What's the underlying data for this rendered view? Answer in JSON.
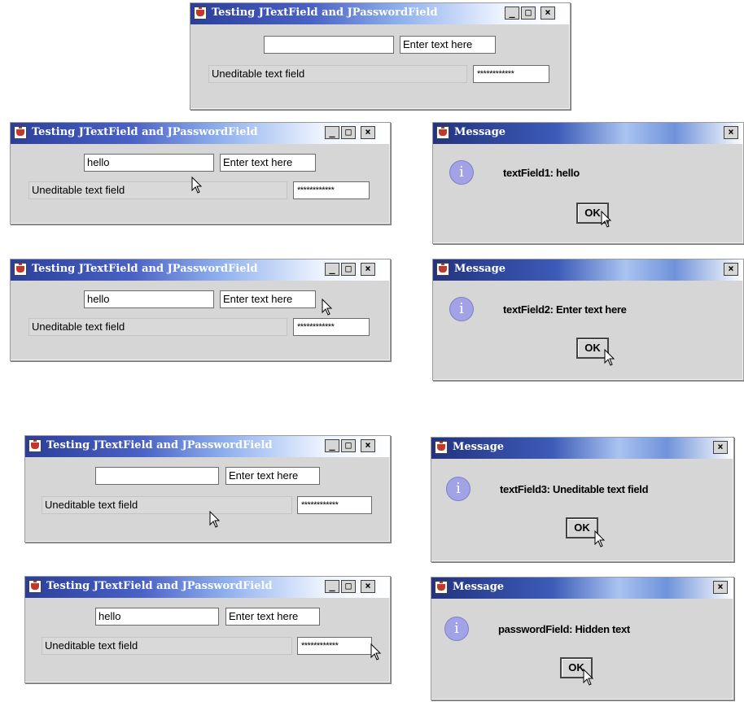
{
  "main_window": {
    "title": "Testing JTextField and JPasswordField",
    "text_field_1_value": "",
    "text_field_2_value": "Enter text here",
    "text_field_3_value": "Uneditable text field",
    "password_field_value": "************"
  },
  "panels": [
    {
      "title": "Testing JTextField and JPasswordField",
      "text_field_1_value": "hello",
      "text_field_2_value": "Enter text here",
      "text_field_3_value": "Uneditable text field",
      "password_field_value": "************",
      "dialog": {
        "title": "Message",
        "message": "textField1: hello",
        "ok_label": "OK"
      }
    },
    {
      "title": "Testing JTextField and JPasswordField",
      "text_field_1_value": "hello",
      "text_field_2_value": "Enter text here",
      "text_field_3_value": "Uneditable text field",
      "password_field_value": "************",
      "dialog": {
        "title": "Message",
        "message": "textField2: Enter text here",
        "ok_label": "OK"
      }
    },
    {
      "title": "Testing JTextField and JPasswordField",
      "text_field_1_value": "",
      "text_field_2_value": "Enter text here",
      "text_field_3_value": "Uneditable text field",
      "password_field_value": "************",
      "dialog": {
        "title": "Message",
        "message": "textField3: Uneditable text field",
        "ok_label": "OK"
      }
    },
    {
      "title": "Testing JTextField and JPasswordField",
      "text_field_1_value": "hello",
      "text_field_2_value": "Enter text here",
      "text_field_3_value": "Uneditable text field",
      "password_field_value": "************",
      "dialog": {
        "title": "Message",
        "message": "passwordField: Hidden text",
        "ok_label": "OK"
      }
    }
  ],
  "window_controls": {
    "minimize_glyph": "_",
    "maximize_glyph": "□",
    "close_glyph": "×"
  },
  "info_icon_glyph": "i",
  "icons": [
    "app-cup-icon",
    "info-icon",
    "mouse-pointer-icon"
  ],
  "colors": {
    "window_bg": "#d6d6d6",
    "title_dark": "#2b3f9a",
    "info_icon": "#a2a2e6"
  }
}
